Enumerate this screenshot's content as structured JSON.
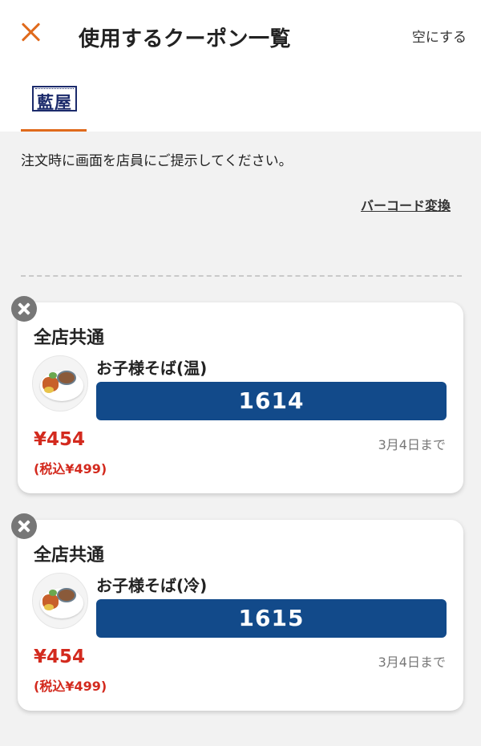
{
  "header": {
    "title": "使用するクーポン一覧",
    "clear_label": "空にする"
  },
  "tabs": [
    {
      "logo_text": "藍屋",
      "active": true
    }
  ],
  "instruction": "注文時に画面を店員にご提示してください。",
  "barcode_link": "バーコード変換",
  "coupons": [
    {
      "scope": "全店共通",
      "item_name": "お子様そば(温)",
      "code": "1614",
      "price": "¥454",
      "price_tax": "(税込¥499)",
      "expiry": "3月4日まで"
    },
    {
      "scope": "全店共通",
      "item_name": "お子様そば(冷)",
      "code": "1615",
      "price": "¥454",
      "price_tax": "(税込¥499)",
      "expiry": "3月4日まで"
    }
  ],
  "colors": {
    "accent": "#e06a1c",
    "code_bar": "#124a8a",
    "price": "#d32a1e"
  }
}
